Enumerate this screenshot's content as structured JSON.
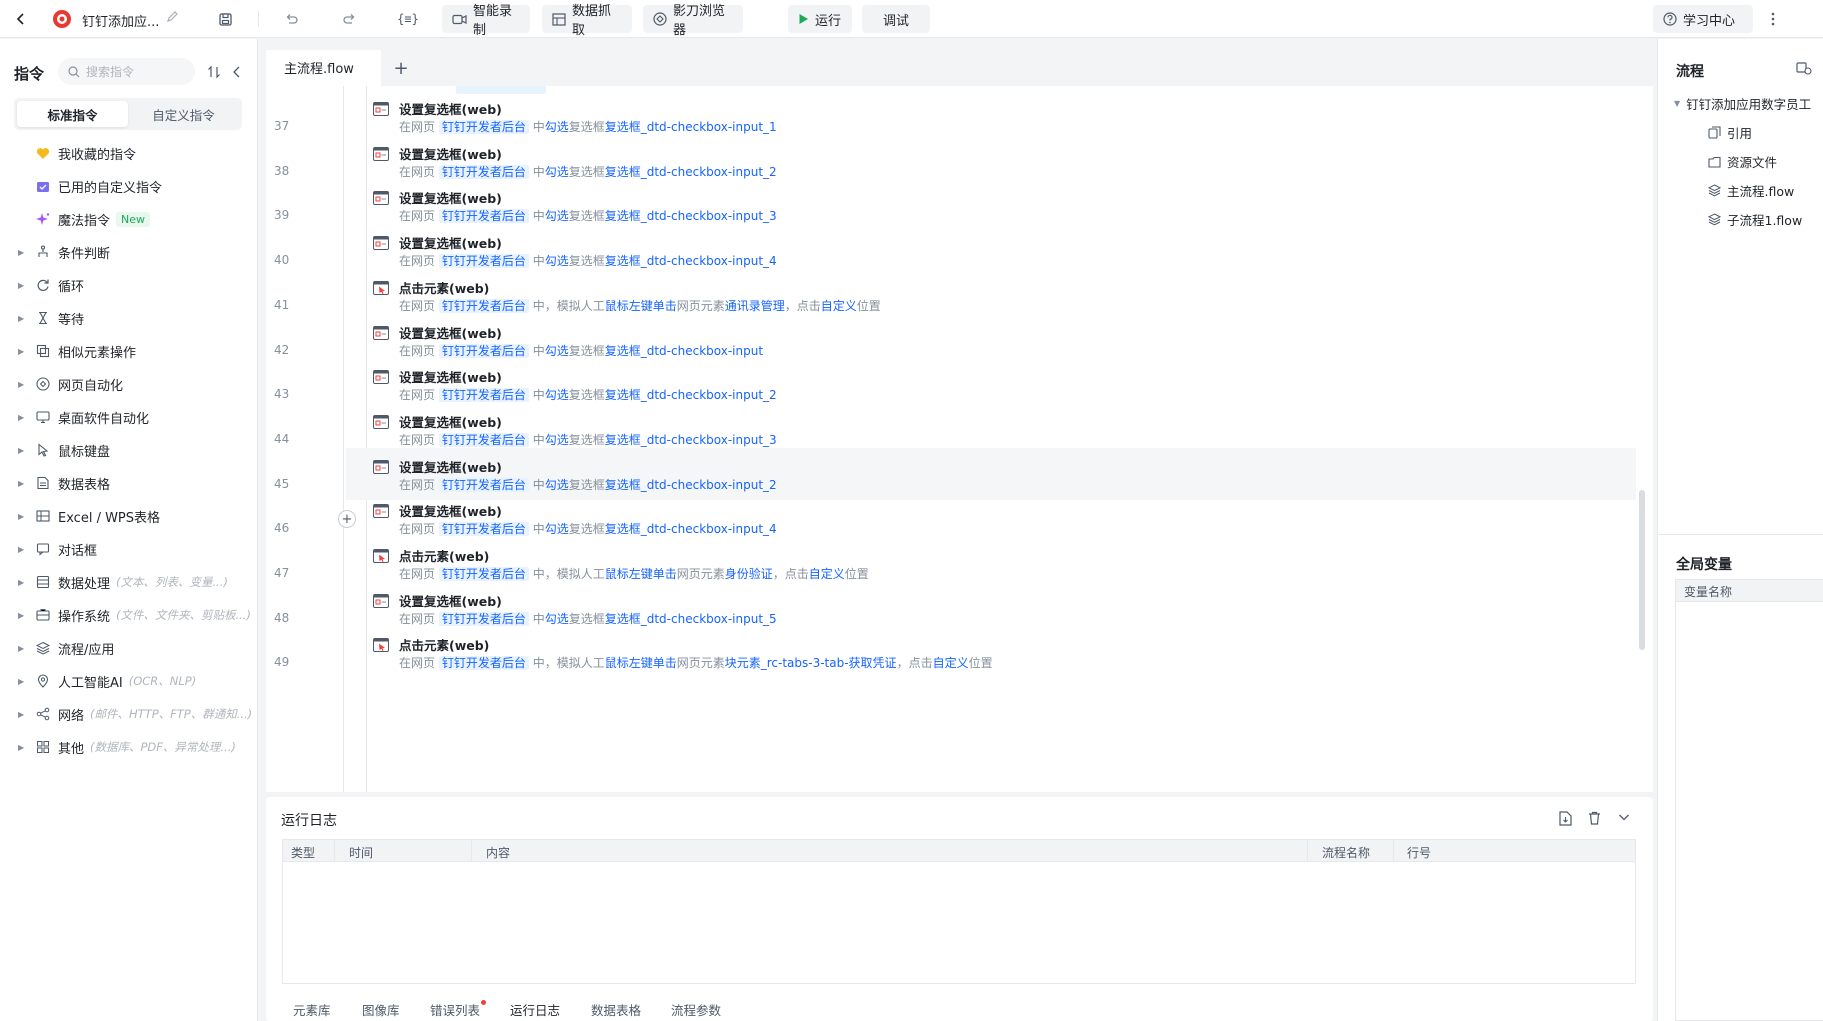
{
  "toolbar": {
    "app_title": "钉钉添加应...",
    "buttons": {
      "variable": "{≡}",
      "smart_record": "智能录制",
      "data_capture": "数据抓取",
      "browser": "影刀浏览器",
      "run": "运行",
      "debug": "调试",
      "learning": "学习中心"
    },
    "colors": {
      "run_green": "#1fa855",
      "brand_red": "#e8382f"
    }
  },
  "left_panel": {
    "title": "指令",
    "search_placeholder": "搜索指令",
    "tabs": [
      "标准指令",
      "自定义指令"
    ],
    "special_items": [
      {
        "label": "我收藏的指令",
        "icon": "heart-icon"
      },
      {
        "label": "已用的自定义指令",
        "icon": "custom-box-icon"
      },
      {
        "label": "魔法指令",
        "icon": "sparkle-icon",
        "badge": "New"
      }
    ],
    "categories": [
      {
        "label": "条件判断",
        "icon": "branch-icon",
        "sub": ""
      },
      {
        "label": "循环",
        "icon": "loop-icon",
        "sub": ""
      },
      {
        "label": "等待",
        "icon": "hourglass-icon",
        "sub": ""
      },
      {
        "label": "相似元素操作",
        "icon": "similar-element-icon",
        "sub": ""
      },
      {
        "label": "网页自动化",
        "icon": "web-icon",
        "sub": ""
      },
      {
        "label": "桌面软件自动化",
        "icon": "desktop-icon",
        "sub": ""
      },
      {
        "label": "鼠标键盘",
        "icon": "cursor-icon",
        "sub": ""
      },
      {
        "label": "数据表格",
        "icon": "table-icon",
        "sub": ""
      },
      {
        "label": "Excel / WPS表格",
        "icon": "excel-icon",
        "sub": ""
      },
      {
        "label": "对话框",
        "icon": "dialog-icon",
        "sub": ""
      },
      {
        "label": "数据处理",
        "icon": "data-process-icon",
        "sub": "(文本、列表、变量...)"
      },
      {
        "label": "操作系统",
        "icon": "os-icon",
        "sub": "(文件、文件夹、剪贴板...)"
      },
      {
        "label": "流程/应用",
        "icon": "layers-icon",
        "sub": ""
      },
      {
        "label": "人工智能AI",
        "icon": "ai-icon",
        "sub": "(OCR、NLP)"
      },
      {
        "label": "网络",
        "icon": "network-icon",
        "sub": "(邮件、HTTP、FTP、群通知...)"
      },
      {
        "label": "其他",
        "icon": "grid-icon",
        "sub": "(数据库、PDF、异常处理...)"
      }
    ]
  },
  "editor": {
    "tab": "主流程.flow",
    "steps": [
      {
        "line": "37",
        "type": "checkbox",
        "title": "设置复选框(web)",
        "page": "钉钉开发者后台",
        "mid": "中",
        "action": "勾选",
        "obj_label": "复选框",
        "target": "复选框_dtd-checkbox-input_1"
      },
      {
        "line": "38",
        "type": "checkbox",
        "title": "设置复选框(web)",
        "page": "钉钉开发者后台",
        "mid": "中",
        "action": "勾选",
        "obj_label": "复选框",
        "target": "复选框_dtd-checkbox-input_2"
      },
      {
        "line": "39",
        "type": "checkbox",
        "title": "设置复选框(web)",
        "page": "钉钉开发者后台",
        "mid": "中",
        "action": "勾选",
        "obj_label": "复选框",
        "target": "复选框_dtd-checkbox-input_3"
      },
      {
        "line": "40",
        "type": "checkbox",
        "title": "设置复选框(web)",
        "page": "钉钉开发者后台",
        "mid": "中",
        "action": "勾选",
        "obj_label": "复选框",
        "target": "复选框_dtd-checkbox-input_4"
      },
      {
        "line": "41",
        "type": "click",
        "title": "点击元素(web)",
        "page": "钉钉开发者后台",
        "mid": "中，模拟人工",
        "action": "鼠标左键单击",
        "obj_label": "网页元素",
        "target": "通讯录管理",
        "suffix_pre": "，点击",
        "suffix_kw": "自定义",
        "suffix_post": "位置"
      },
      {
        "line": "42",
        "type": "checkbox",
        "title": "设置复选框(web)",
        "page": "钉钉开发者后台",
        "mid": "中",
        "action": "勾选",
        "obj_label": "复选框",
        "target": "复选框_dtd-checkbox-input"
      },
      {
        "line": "43",
        "type": "checkbox",
        "title": "设置复选框(web)",
        "page": "钉钉开发者后台",
        "mid": "中",
        "action": "勾选",
        "obj_label": "复选框",
        "target": "复选框_dtd-checkbox-input_2"
      },
      {
        "line": "44",
        "type": "checkbox",
        "title": "设置复选框(web)",
        "page": "钉钉开发者后台",
        "mid": "中",
        "action": "勾选",
        "obj_label": "复选框",
        "target": "复选框_dtd-checkbox-input_3"
      },
      {
        "line": "45",
        "type": "checkbox",
        "title": "设置复选框(web)",
        "page": "钉钉开发者后台",
        "mid": "中",
        "action": "勾选",
        "obj_label": "复选框",
        "target": "复选框_dtd-checkbox-input_2",
        "highlight": true
      },
      {
        "line": "46",
        "type": "checkbox",
        "title": "设置复选框(web)",
        "page": "钉钉开发者后台",
        "mid": "中",
        "action": "勾选",
        "obj_label": "复选框",
        "target": "复选框_dtd-checkbox-input_4"
      },
      {
        "line": "47",
        "type": "click",
        "title": "点击元素(web)",
        "page": "钉钉开发者后台",
        "mid": "中，模拟人工",
        "action": "鼠标左键单击",
        "obj_label": "网页元素",
        "target": "身份验证",
        "suffix_pre": "，点击",
        "suffix_kw": "自定义",
        "suffix_post": "位置"
      },
      {
        "line": "48",
        "type": "checkbox",
        "title": "设置复选框(web)",
        "page": "钉钉开发者后台",
        "mid": "中",
        "action": "勾选",
        "obj_label": "复选框",
        "target": "复选框_dtd-checkbox-input_5"
      },
      {
        "line": "49",
        "type": "click",
        "title": "点击元素(web)",
        "page": "钉钉开发者后台",
        "mid": "中，模拟人工",
        "action": "鼠标左键单击",
        "obj_label": "网页元素",
        "target": "块元素_rc-tabs-3-tab-获取凭证",
        "suffix_pre": "，点击",
        "suffix_kw": "自定义",
        "suffix_post": "位置"
      }
    ],
    "desc_prefix": "在网页"
  },
  "log": {
    "title": "运行日志",
    "columns": [
      "类型",
      "时间",
      "内容",
      "流程名称",
      "行号"
    ],
    "bottom_tabs": [
      "元素库",
      "图像库",
      "错误列表",
      "运行日志",
      "数据表格",
      "流程参数"
    ],
    "active_tab": "运行日志",
    "error_tab": "错误列表"
  },
  "right_panel": {
    "title": "流程",
    "root": "钉钉添加应用数字员工",
    "items": [
      {
        "label": "引用",
        "icon": "reference-icon"
      },
      {
        "label": "资源文件",
        "icon": "resource-file-icon"
      },
      {
        "label": "主流程.flow",
        "icon": "flow-layers-icon"
      },
      {
        "label": "子流程1.flow",
        "icon": "flow-layers-icon"
      }
    ],
    "vars_title": "全局变量",
    "vars_column": "变量名称"
  }
}
